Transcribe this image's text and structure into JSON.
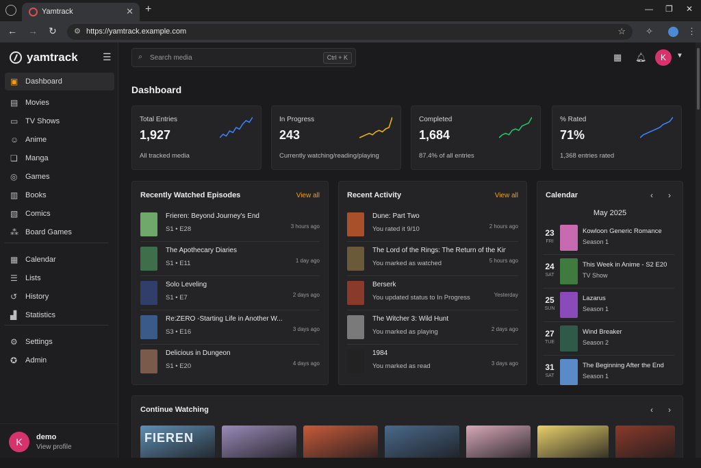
{
  "browser": {
    "tab_title": "Yamtrack",
    "url": "https://yamtrack.example.com"
  },
  "sidebar": {
    "brand": "yamtrack",
    "items": [
      {
        "label": "Dashboard",
        "icon": "dashboard-icon"
      },
      {
        "label": "Movies",
        "icon": "film-icon"
      },
      {
        "label": "TV Shows",
        "icon": "tv-icon"
      },
      {
        "label": "Anime",
        "icon": "anime-icon"
      },
      {
        "label": "Manga",
        "icon": "book-open-icon"
      },
      {
        "label": "Games",
        "icon": "gamepad-icon"
      },
      {
        "label": "Books",
        "icon": "book-icon"
      },
      {
        "label": "Comics",
        "icon": "comic-icon"
      },
      {
        "label": "Board Games",
        "icon": "board-game-icon"
      },
      {
        "label": "Calendar",
        "icon": "calendar-icon"
      },
      {
        "label": "Lists",
        "icon": "list-icon"
      },
      {
        "label": "History",
        "icon": "history-icon"
      },
      {
        "label": "Statistics",
        "icon": "chart-icon"
      },
      {
        "label": "Settings",
        "icon": "gear-icon"
      },
      {
        "label": "Admin",
        "icon": "admin-icon"
      }
    ],
    "user": {
      "initial": "K",
      "name": "demo",
      "link": "View profile"
    }
  },
  "header": {
    "search_placeholder": "Search media",
    "shortcut": "Ctrl + K",
    "avatar_initial": "K"
  },
  "page_title": "Dashboard",
  "stats": [
    {
      "label": "Total Entries",
      "value": "1,927",
      "sub": "All tracked media",
      "color": "#3b82f6",
      "trend": [
        2,
        3,
        2.5,
        4,
        3.5,
        5,
        4.5,
        6,
        7,
        6.5,
        8
      ]
    },
    {
      "label": "In Progress",
      "value": "243",
      "sub": "Currently watching/reading/playing",
      "color": "#eab308",
      "trend": [
        1,
        1.5,
        2,
        2.5,
        2,
        3,
        3.5,
        3,
        4,
        4.5,
        8
      ]
    },
    {
      "label": "Completed",
      "value": "1,684",
      "sub": "87.4% of all entries",
      "color": "#22c55e",
      "trend": [
        1,
        2,
        2.5,
        2,
        3.5,
        4,
        3.5,
        5,
        5.5,
        6,
        8
      ]
    },
    {
      "label": "% Rated",
      "value": "71%",
      "sub": "1,368 entries rated",
      "color": "#3b82f6",
      "trend": [
        1,
        2,
        2.5,
        3,
        3.5,
        4,
        4.5,
        5.5,
        6,
        6.5,
        8
      ]
    }
  ],
  "recent_episodes": {
    "title": "Recently Watched Episodes",
    "link": "View all",
    "items": [
      {
        "title": "Frieren: Beyond Journey's End",
        "sub": "S1 • E28",
        "time": "3 hours ago",
        "color": "#6fa86a"
      },
      {
        "title": "The Apothecary Diaries",
        "sub": "S1 • E11",
        "time": "1 day ago",
        "color": "#3f6f4a"
      },
      {
        "title": "Solo Leveling",
        "sub": "S1 • E7",
        "time": "2 days ago",
        "color": "#2f3f6a"
      },
      {
        "title": "Re:ZERO -Starting Life in Another W...",
        "sub": "S3 • E16",
        "time": "3 days ago",
        "color": "#3a5a8a"
      },
      {
        "title": "Delicious in Dungeon",
        "sub": "S1 • E20",
        "time": "4 days ago",
        "color": "#7a5a4a"
      }
    ]
  },
  "recent_activity": {
    "title": "Recent Activity",
    "link": "View all",
    "items": [
      {
        "title": "Dune: Part Two",
        "sub": "You rated it 9/10",
        "time": "2 hours ago",
        "color": "#a8502a"
      },
      {
        "title": "The Lord of the Rings: The Return of the King",
        "sub": "You marked as watched",
        "time": "5 hours ago",
        "color": "#6a5a3a"
      },
      {
        "title": "Berserk",
        "sub": "You updated status to In Progress",
        "time": "Yesterday",
        "color": "#8a3a2a"
      },
      {
        "title": "The Witcher 3: Wild Hunt",
        "sub": "You marked as playing",
        "time": "2 days ago",
        "color": "#7a7a7a"
      },
      {
        "title": "1984",
        "sub": "You marked as read",
        "time": "3 days ago",
        "color": "#222222"
      }
    ]
  },
  "calendar": {
    "title": "Calendar",
    "month": "May 2025",
    "items": [
      {
        "day": "23",
        "dow": "FRI",
        "title": "Kowloon Generic Romance",
        "sub": "Season 1",
        "color": "#c86ab0"
      },
      {
        "day": "24",
        "dow": "SAT",
        "title": "This Week in Anime - S2 E20",
        "sub": "TV Show",
        "color": "#3f7a3f"
      },
      {
        "day": "25",
        "dow": "SUN",
        "title": "Lazarus",
        "sub": "Season 1",
        "color": "#8a4aba"
      },
      {
        "day": "27",
        "dow": "TUE",
        "title": "Wind Breaker",
        "sub": "Season 2",
        "color": "#2f5a4a"
      },
      {
        "day": "31",
        "dow": "SAT",
        "title": "The Beginning After the End",
        "sub": "Season 1",
        "color": "#5a8ac8"
      }
    ]
  },
  "continue_watching": {
    "title": "Continue Watching",
    "items": [
      {
        "caption": "FIEREN",
        "color": "#5f8fb4"
      },
      {
        "caption": "",
        "color": "#9a8ab8"
      },
      {
        "caption": "",
        "color": "#c85a3a"
      },
      {
        "caption": "",
        "color": "#4a6a8a"
      },
      {
        "caption": "",
        "color": "#d8a8b8"
      },
      {
        "caption": "",
        "color": "#e8d06a"
      },
      {
        "caption": "",
        "color": "#8a3a2a"
      }
    ]
  }
}
